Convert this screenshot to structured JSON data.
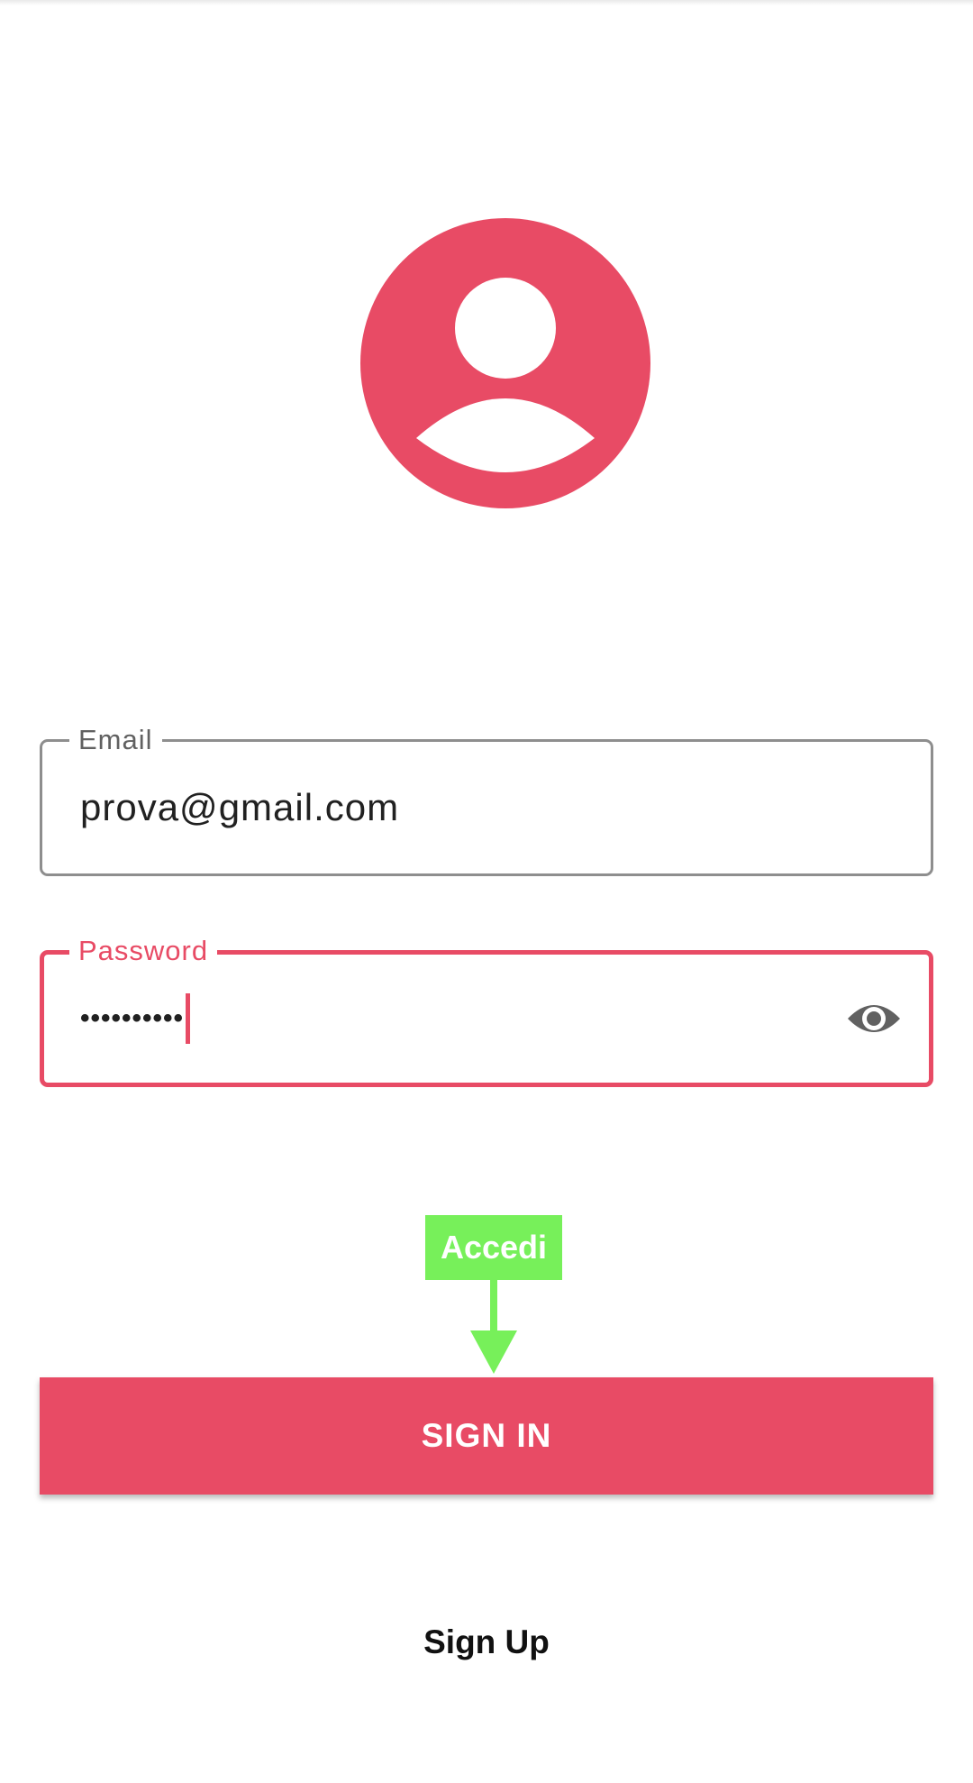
{
  "profile": {
    "avatar_icon": "account-circle-icon",
    "accent_color": "#e84b65"
  },
  "form": {
    "email": {
      "label": "Email",
      "value": "prova@gmail.com"
    },
    "password": {
      "label": "Password",
      "masked_value": "••••••••••",
      "toggle_icon": "eye-icon"
    }
  },
  "annotation": {
    "label": "Accedi",
    "color": "#77f05a",
    "icon": "arrow-down-icon"
  },
  "actions": {
    "sign_in_label": "SIGN IN",
    "sign_up_label": "Sign Up"
  }
}
